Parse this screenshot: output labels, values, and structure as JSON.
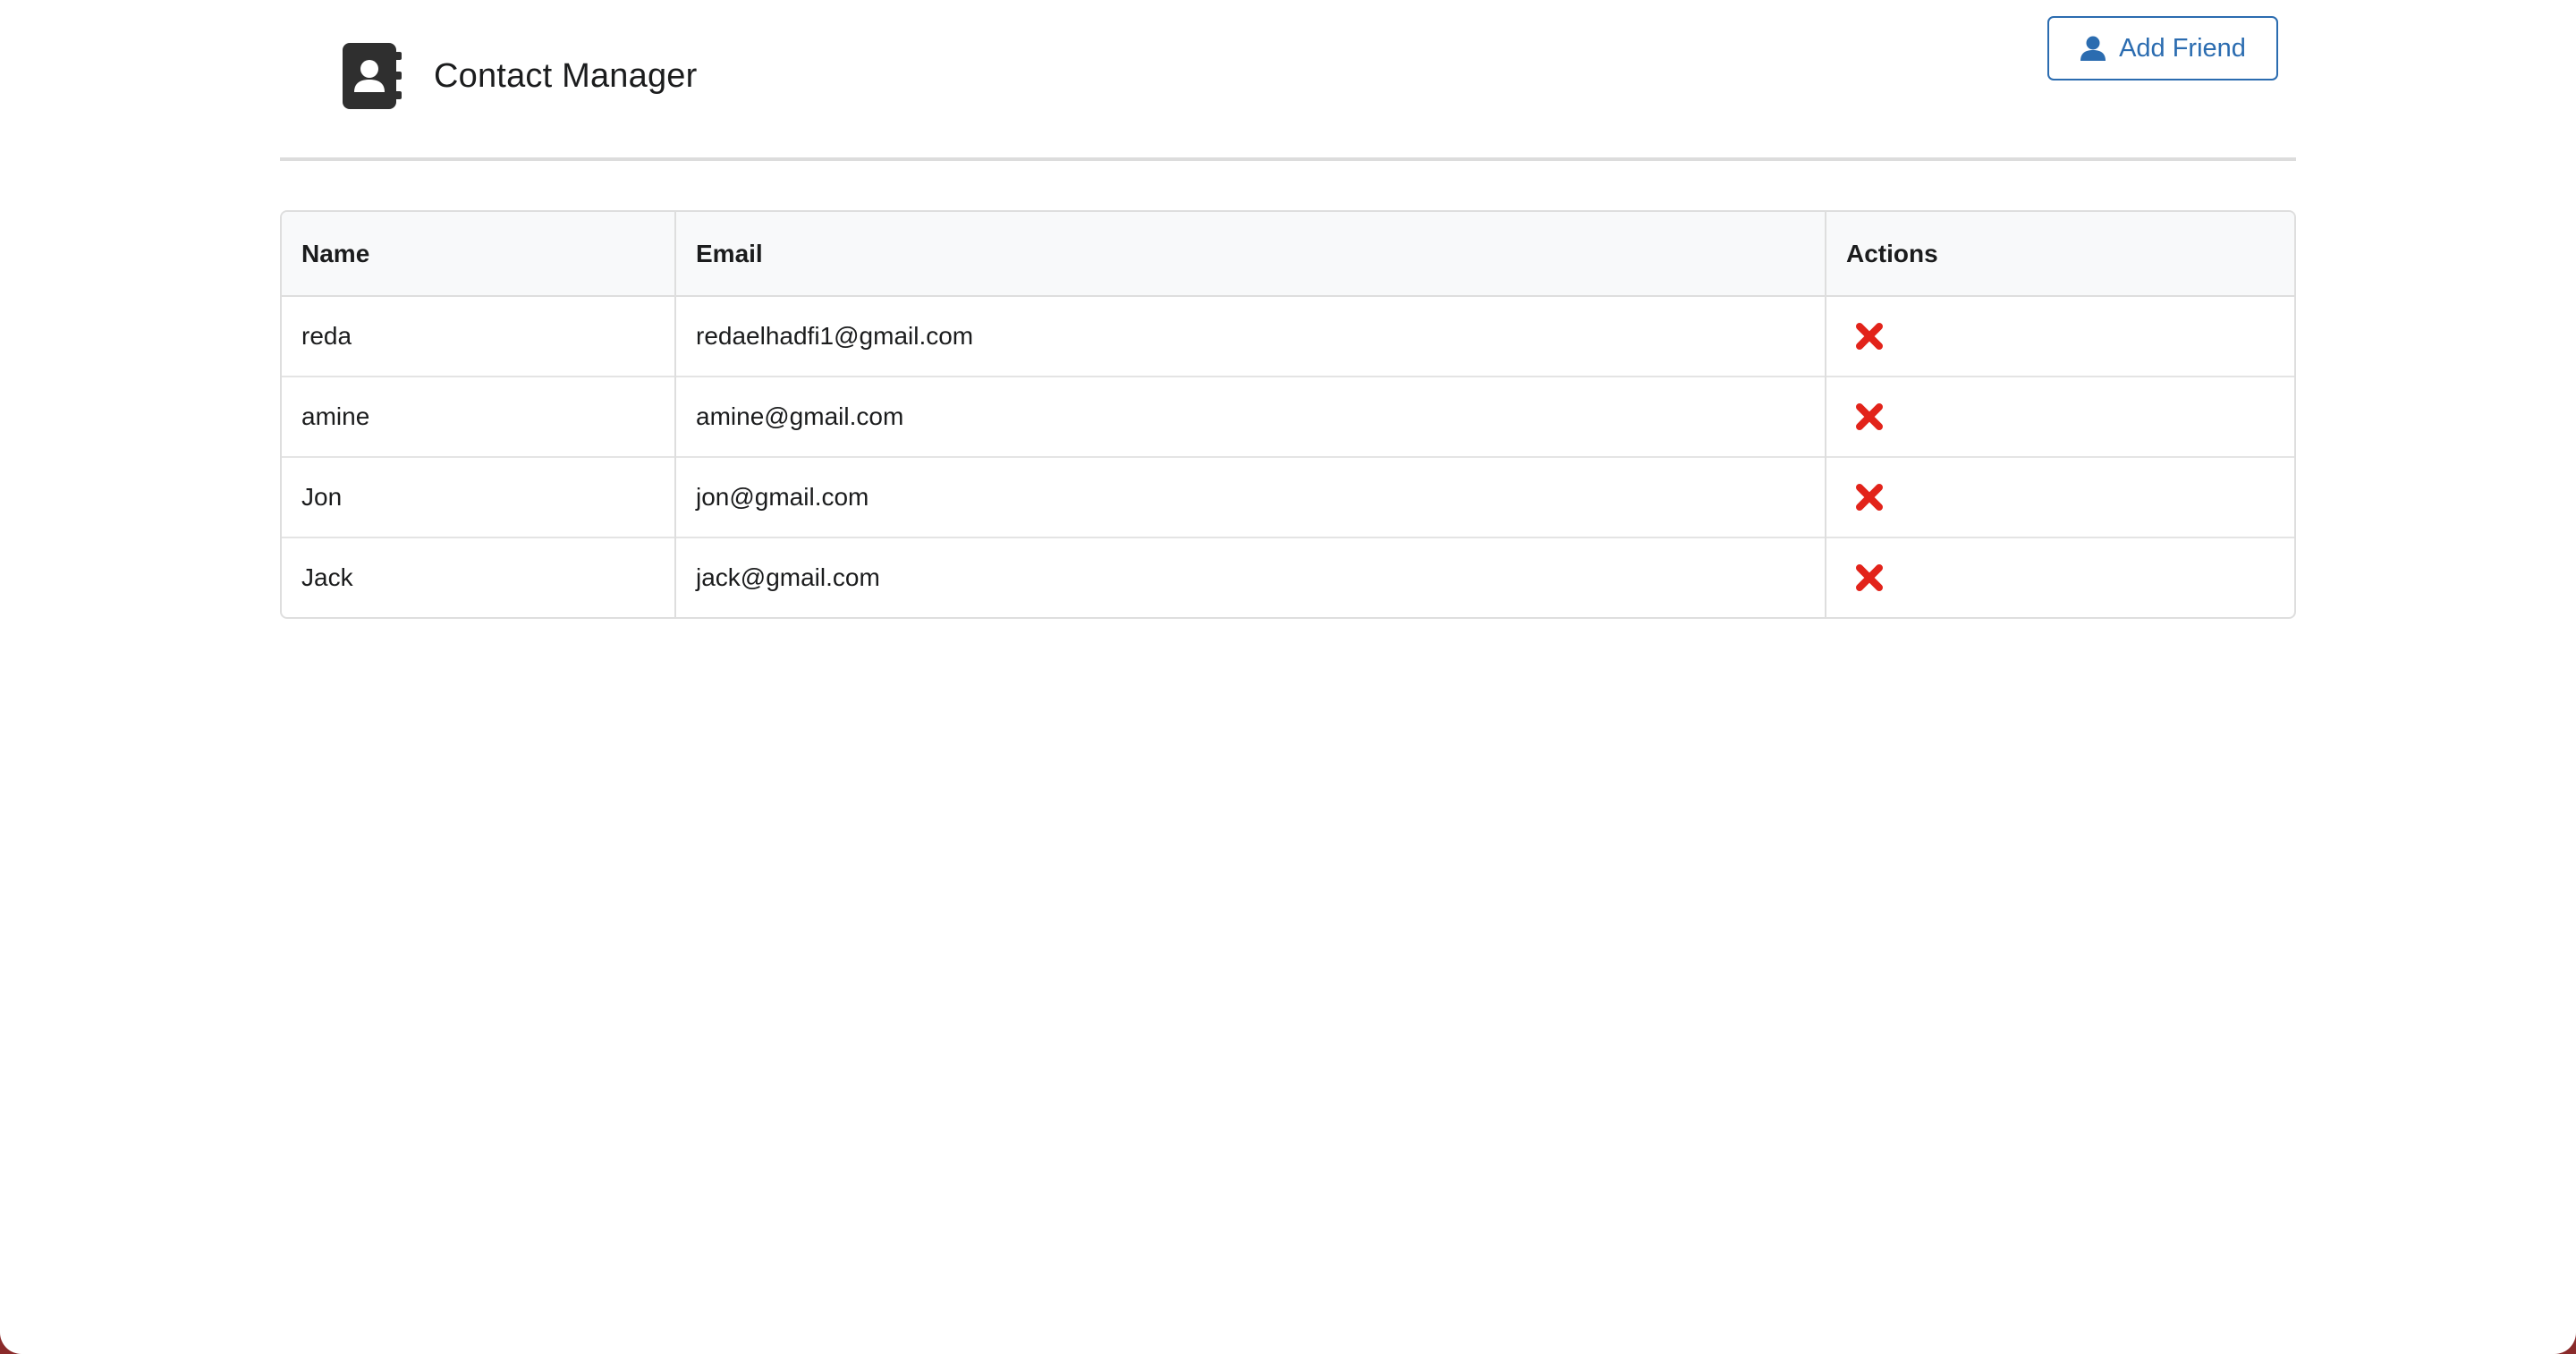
{
  "header": {
    "title": "Contact Manager",
    "logo_icon": "address-book-icon",
    "add_button": {
      "label": "Add Friend",
      "icon": "user-icon",
      "color": "#2b6cb0"
    }
  },
  "table": {
    "columns": [
      "Name",
      "Email",
      "Actions"
    ],
    "rows": [
      {
        "name": "reda",
        "email": "redaelhadfi1@gmail.com",
        "action_icon": "delete-x-icon"
      },
      {
        "name": "amine",
        "email": "amine@gmail.com",
        "action_icon": "delete-x-icon"
      },
      {
        "name": "Jon",
        "email": "jon@gmail.com",
        "action_icon": "delete-x-icon"
      },
      {
        "name": "Jack",
        "email": "jack@gmail.com",
        "action_icon": "delete-x-icon"
      }
    ],
    "delete_color": "#e2231a"
  }
}
